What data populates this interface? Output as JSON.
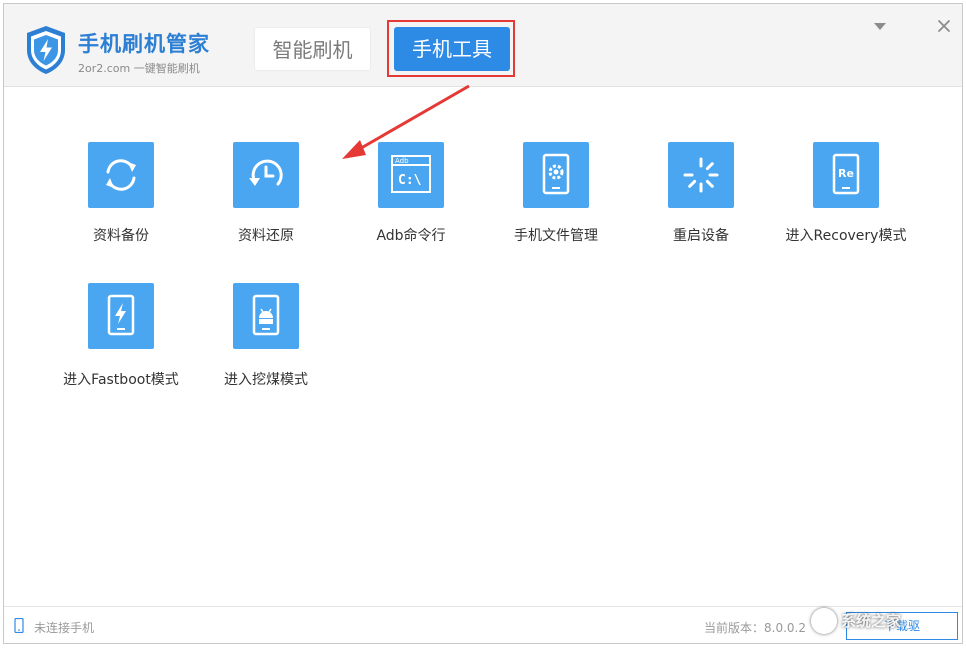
{
  "app": {
    "title": "手机刷机管家",
    "subtitle": "2or2.com 一键智能刷机"
  },
  "tabs": [
    {
      "label": "智能刷机",
      "active": false
    },
    {
      "label": "手机工具",
      "active": true
    }
  ],
  "tools": [
    {
      "label": "资料备份",
      "icon": "sync-icon"
    },
    {
      "label": "资料还原",
      "icon": "restore-clock-icon"
    },
    {
      "label": "Adb命令行",
      "icon": "terminal-icon",
      "icon_text": "C:\\",
      "icon_caption": "Adb"
    },
    {
      "label": "手机文件管理",
      "icon": "phone-gear-icon"
    },
    {
      "label": "重启设备",
      "icon": "loading-spinner-icon"
    },
    {
      "label": "进入Recovery模式",
      "icon": "phone-recovery-icon",
      "icon_text": "Re"
    },
    {
      "label": "进入Fastboot模式",
      "icon": "phone-lightning-icon"
    },
    {
      "label": "进入挖煤模式",
      "icon": "phone-android-icon"
    }
  ],
  "status": {
    "connection": "未连接手机",
    "version": "当前版本：8.0.0.2",
    "button_label": "下载驱"
  },
  "watermark": "系统之家",
  "colors": {
    "accent": "#2d8ae5",
    "tile": "#4aa6f0",
    "title": "#2c7fd3",
    "highlight": "#e53935"
  }
}
